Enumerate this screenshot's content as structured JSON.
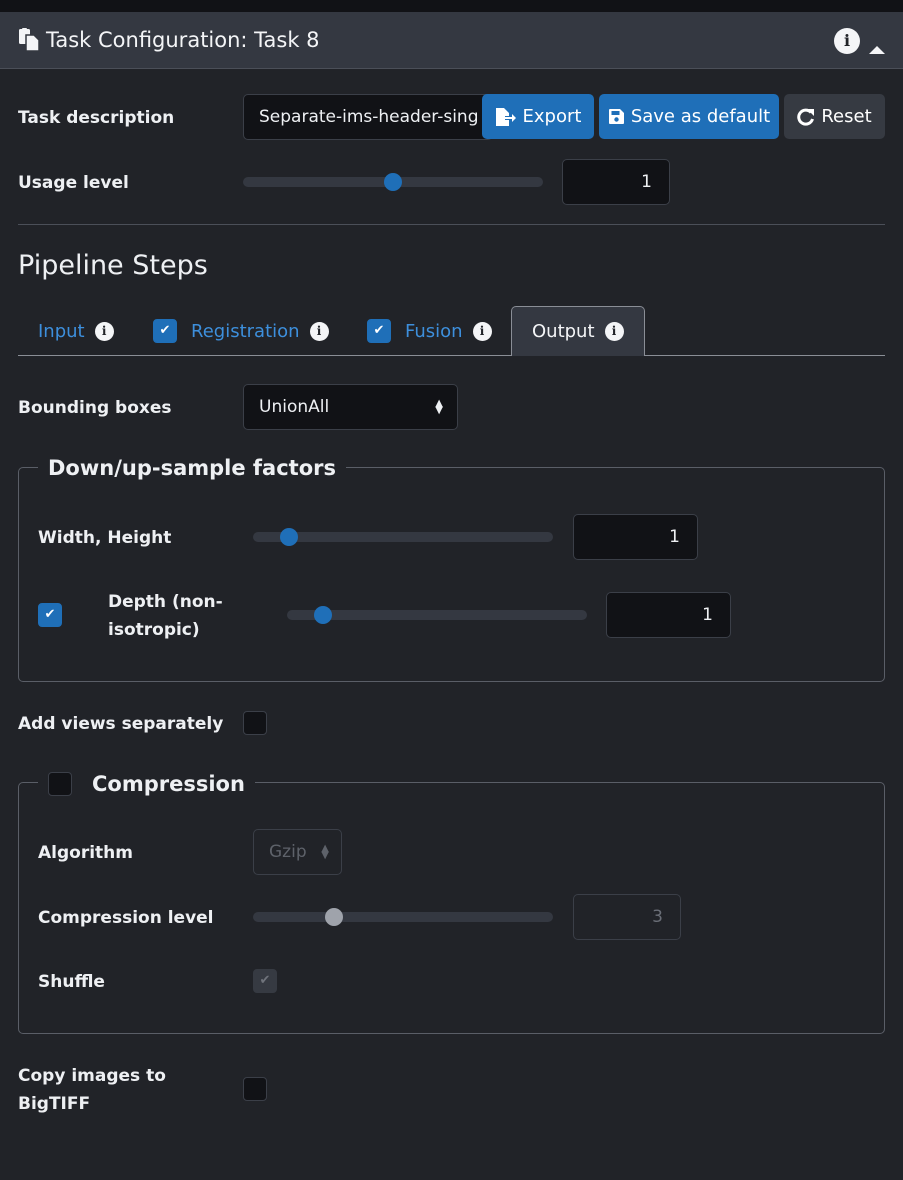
{
  "header": {
    "title": "Task Configuration: Task 8",
    "icon": "copy-icon",
    "info_icon": "info-circle-icon",
    "collapse_icon": "caret-up-icon"
  },
  "task_description": {
    "label": "Task description",
    "value": "Separate-ims-header-sing"
  },
  "toolbar": {
    "export_label": "Export",
    "save_default_label": "Save as default",
    "reset_label": "Reset"
  },
  "usage_level": {
    "label": "Usage level",
    "value": "1",
    "slider_fraction": 0.5
  },
  "pipeline": {
    "title": "Pipeline Steps",
    "tabs": [
      {
        "label": "Input",
        "checkable": false,
        "checked": false,
        "active": false
      },
      {
        "label": "Registration",
        "checkable": true,
        "checked": true,
        "active": false
      },
      {
        "label": "Fusion",
        "checkable": true,
        "checked": true,
        "active": false
      },
      {
        "label": "Output",
        "checkable": false,
        "checked": false,
        "active": true
      }
    ]
  },
  "output": {
    "bounding_boxes": {
      "label": "Bounding boxes",
      "value": "UnionAll"
    },
    "sample_factors": {
      "legend": "Down/up-sample factors",
      "width_height": {
        "label": "Width, Height",
        "value": "1",
        "slider_fraction": 0.12
      },
      "depth": {
        "label": "Depth (non-isotropic)",
        "label_line1": "Depth (non-",
        "label_line2": "isotropic)",
        "checked": true,
        "value": "1",
        "slider_fraction": 0.12
      }
    },
    "add_views_separately": {
      "label": "Add views separately",
      "checked": false
    },
    "compression": {
      "legend": "Compression",
      "enabled": false,
      "algorithm": {
        "label": "Algorithm",
        "value": "Gzip"
      },
      "level": {
        "label": "Compression level",
        "value": "3",
        "slider_fraction": 0.27
      },
      "shuffle": {
        "label": "Shuffle",
        "checked": true
      }
    },
    "copy_bigtiff": {
      "label": "Copy images to BigTIFF",
      "label_line1": "Copy images to",
      "label_line2": "BigTIFF",
      "checked": false
    }
  },
  "colors": {
    "accent": "#1f6fb8",
    "background": "#212328",
    "header": "#343841",
    "tab_link": "#3d8fdc"
  }
}
